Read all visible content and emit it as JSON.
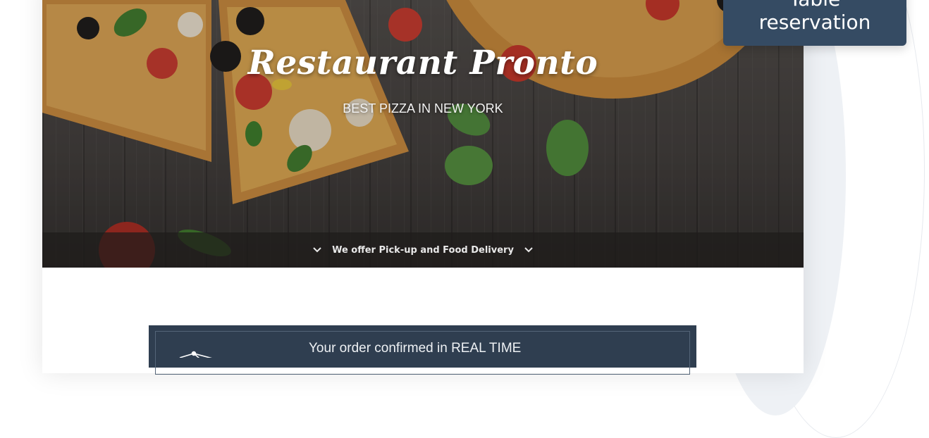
{
  "hero": {
    "title": "Restaurant Pronto",
    "subtitle": "BEST PIZZA IN NEW YORK",
    "bar_text": "We offer Pick-up and Food Delivery",
    "left_icon": "chevron-down-icon",
    "right_icon": "chevron-down-icon"
  },
  "reservation": {
    "line1": "Table",
    "line2": "reservation",
    "color": "#354b63"
  },
  "banner": {
    "text": "Your order confirmed in REAL TIME",
    "icon": "network-icon",
    "color": "#2f3e50"
  }
}
